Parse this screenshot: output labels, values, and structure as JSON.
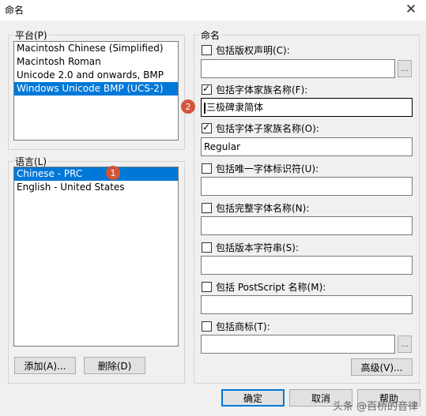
{
  "window": {
    "title": "命名",
    "close_glyph": "✕"
  },
  "platform": {
    "label": "平台(P)",
    "items": [
      "Macintosh Chinese (Simplified)",
      "Macintosh Roman",
      "Unicode 2.0 and onwards, BMP",
      "Windows Unicode BMP (UCS-2)"
    ],
    "selected_index": 3
  },
  "language": {
    "label": "语言(L)",
    "items": [
      "Chinese - PRC",
      "English - United States"
    ],
    "selected_index": 0,
    "add_label": "添加(A)...",
    "delete_label": "删除(D)"
  },
  "naming": {
    "label": "命名",
    "copyright": {
      "label": "包括版权声明(C):",
      "checked": false,
      "value": ""
    },
    "family": {
      "label": "包括字体家族名称(F):",
      "checked": true,
      "value": "三极碑隶简体"
    },
    "subfamily": {
      "label": "包括字体子家族名称(O):",
      "checked": true,
      "value": "Regular"
    },
    "unique_id": {
      "label": "包括唯一字体标识符(U):",
      "checked": false,
      "value": ""
    },
    "full_name": {
      "label": "包括完整字体名称(N):",
      "checked": false,
      "value": ""
    },
    "version": {
      "label": "包括版本字符串(S):",
      "checked": false,
      "value": ""
    },
    "postscript": {
      "label": "包括 PostScript 名称(M):",
      "checked": false,
      "value": ""
    },
    "trademark": {
      "label": "包括商标(T):",
      "checked": false,
      "value": ""
    },
    "dots_label": "...",
    "advanced_label": "高级(V)..."
  },
  "footer": {
    "ok_label": "确定",
    "cancel_label": "取消",
    "help_label": "帮助"
  },
  "badges": [
    "1",
    "2"
  ],
  "watermark": "头条 @百桥的音律",
  "colors": {
    "selection": "#0078d7",
    "badge": "#d2553a"
  }
}
